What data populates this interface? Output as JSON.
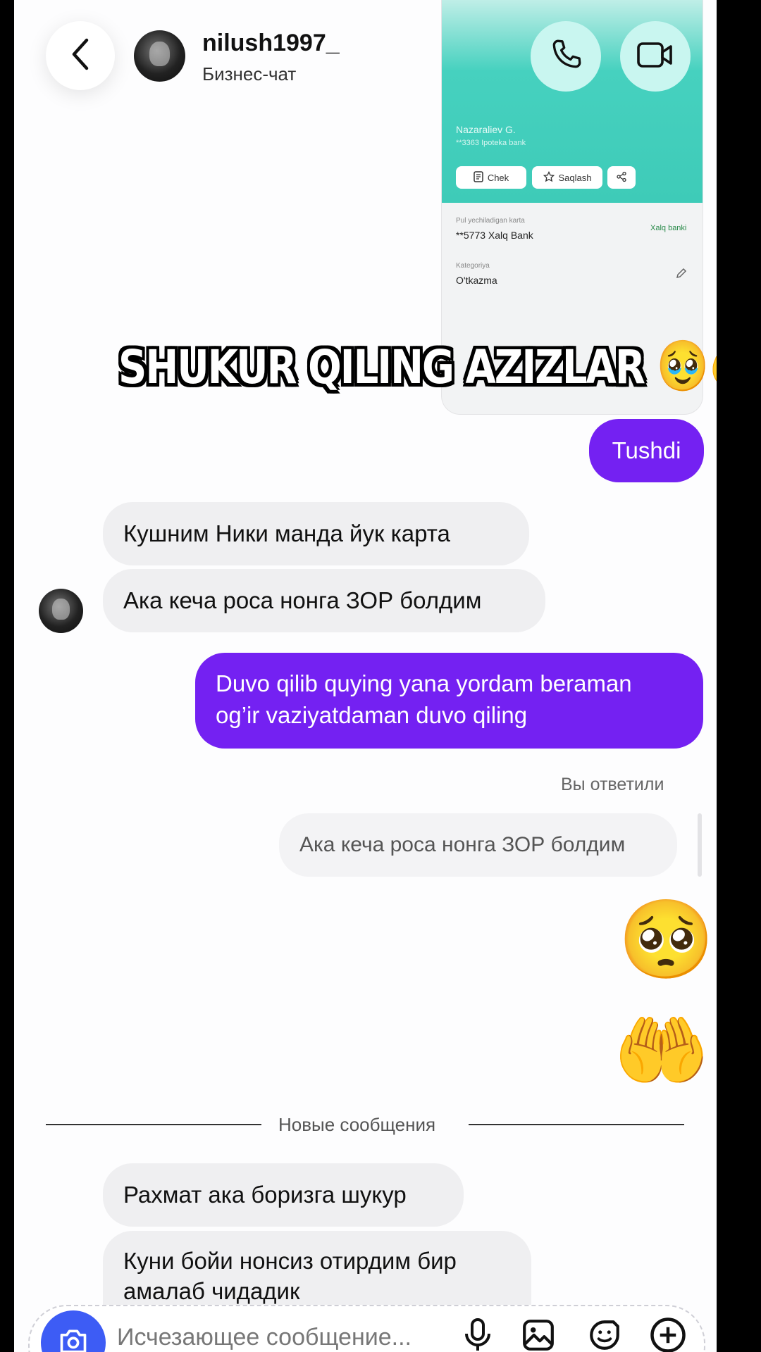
{
  "header": {
    "username": "nilush1997_",
    "subtitle": "Бизнес-чат"
  },
  "receipt": {
    "name": "Nazaraliev G.",
    "account": "**3363 Ipoteka bank",
    "btn_check": "Chek",
    "btn_save": "Saqlash",
    "card_label": "Pul yechiladigan karta",
    "card_value": "**5773 Xalq Bank",
    "bank_logo": "Xalq banki",
    "category_label": "Kategoriya",
    "category_value": "O'tkazma"
  },
  "overlay": {
    "text": "SHUKUR QILING AZIZLAR",
    "emoji": "🥹🤲"
  },
  "messages": {
    "out_1": "Tushdi",
    "in_1": "Кушним Ники манда йук карта",
    "in_2": "Ака кеча роса нонга ЗОР болдим",
    "out_2_line1": "Duvo qilib quying yana yordam beraman",
    "out_2_line2": "og’ir vaziyatdaman duvo qiling",
    "reply_meta": "Вы ответили",
    "reply_quote": "Ака кеча роса нонга ЗОР болдим",
    "emoji_1": "🥺",
    "emoji_2": "🤲",
    "new_divider": "Новые сообщения",
    "in_3": "Рахмат ака боризга шукур",
    "in_4_line1": "Куни бойи нонсиз отирдим бир",
    "in_4_line2": "амалаб чидадик"
  },
  "composer": {
    "placeholder": "Исчезающее сообщение..."
  },
  "colors": {
    "outgoing_bubble": "#7421f2",
    "incoming_bubble": "#efeff1",
    "call_button_bg": "#c9f6f0",
    "camera_button": "#3d5cf5",
    "receipt_teal": "#3ecbb8"
  }
}
